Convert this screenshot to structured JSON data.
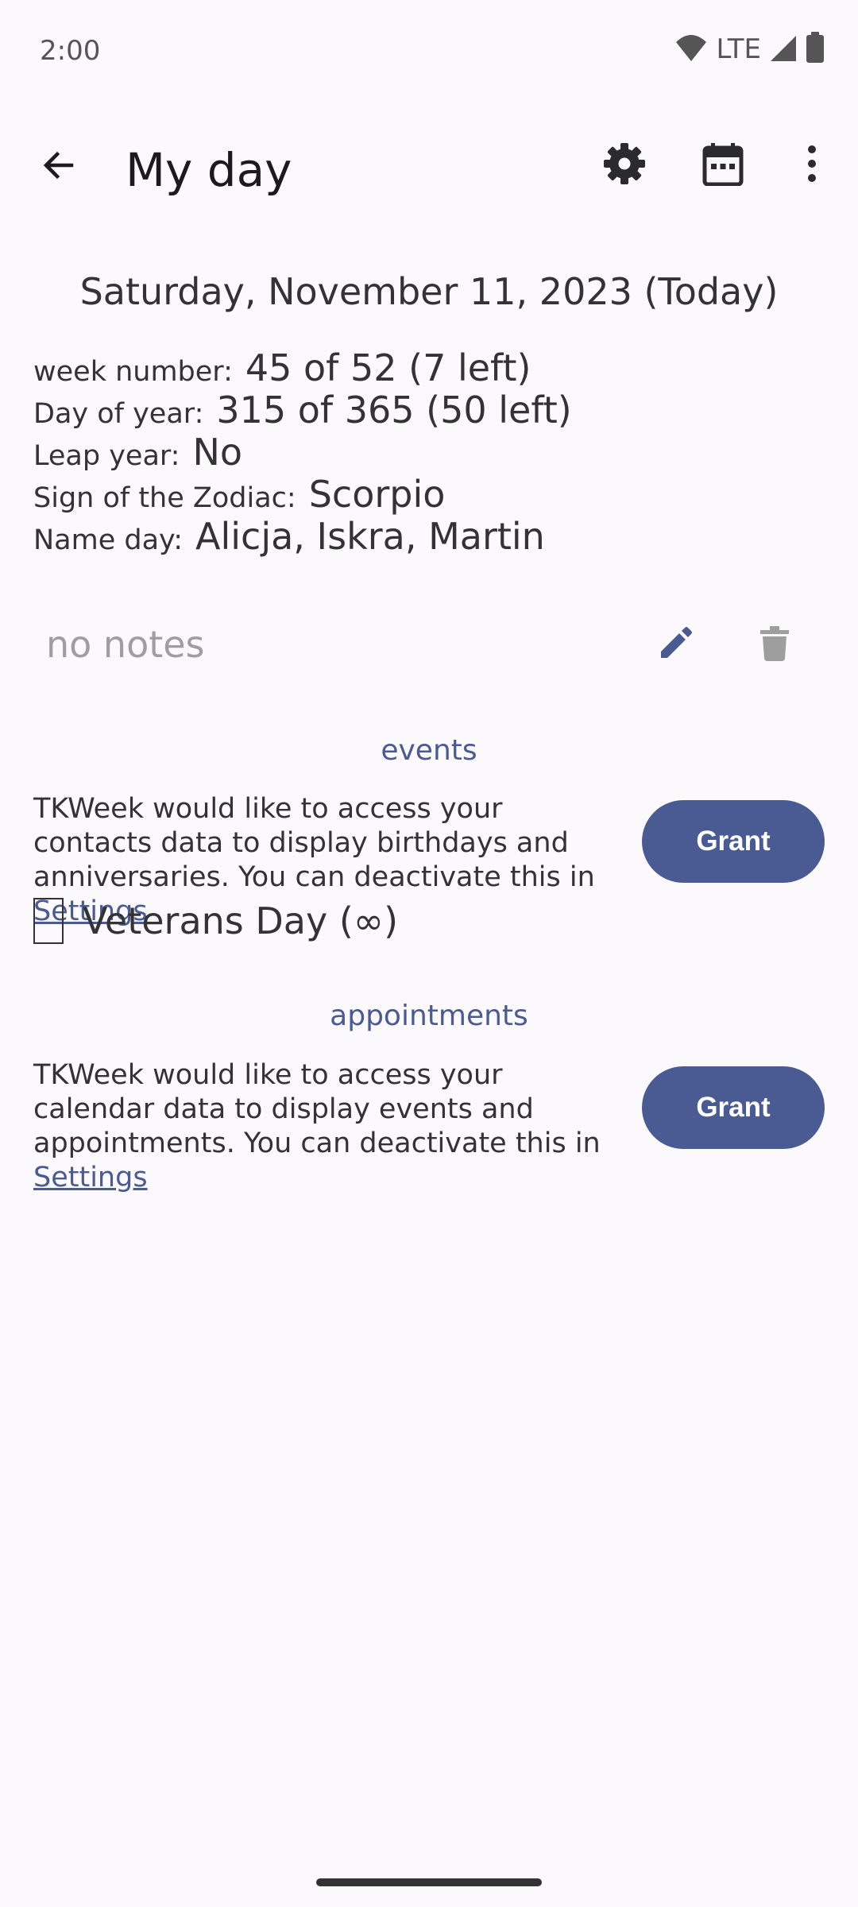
{
  "status_bar": {
    "time": "2:00",
    "network": "LTE",
    "icons": [
      "wifi-icon",
      "signal-icon",
      "battery-icon"
    ]
  },
  "app_bar": {
    "title": "My day",
    "icons": [
      "back-arrow-icon",
      "gear-icon",
      "calendar-icon",
      "more-vert-icon"
    ]
  },
  "date_heading": "Saturday, November 11, 2023 (Today)",
  "info": [
    {
      "label": "week number:",
      "value": "45 of 52 (7 left)"
    },
    {
      "label": "Day of year:",
      "value": "315 of 365 (50 left)"
    },
    {
      "label": "Leap year:",
      "value": "No"
    },
    {
      "label": "Sign of the Zodiac:",
      "value": "Scorpio"
    },
    {
      "label": "Name day:",
      "value": "Alicja, Iskra, Martin"
    }
  ],
  "notes": {
    "text": "no notes",
    "icons": [
      "pencil-icon",
      "trash-icon"
    ]
  },
  "events": {
    "header": "events",
    "permission_text": "TKWeek would like to access your contacts data to display birthdays and anniversaries. You can deactivate this in",
    "link_label": "Settings",
    "grant_label": "Grant",
    "items": [
      {
        "label": "Veterans Day (∞)",
        "checked": false
      }
    ]
  },
  "appointments": {
    "header": "appointments",
    "permission_text": "TKWeek would like to access your calendar data to display events and appointments. You can deactivate this in",
    "link_label": "Settings",
    "grant_label": "Grant"
  },
  "colors": {
    "background": "#fcf9fd",
    "accent": "#4a5b93",
    "text": "#333333",
    "muted": "#9e9e9e"
  }
}
